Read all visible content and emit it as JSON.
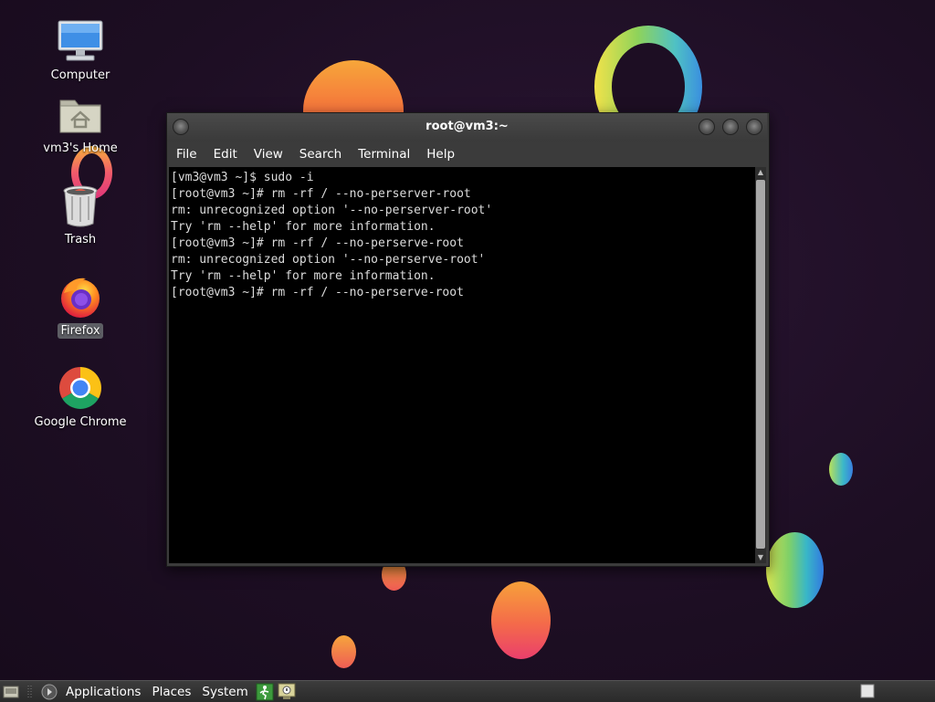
{
  "desktop": {
    "icons": [
      {
        "label": "Computer",
        "icon": "computer-icon"
      },
      {
        "label": "vm3's Home",
        "icon": "home-folder-icon"
      },
      {
        "label": "Trash",
        "icon": "trash-icon"
      },
      {
        "label": "Firefox",
        "icon": "firefox-icon"
      },
      {
        "label": "Google Chrome",
        "icon": "chrome-icon"
      }
    ]
  },
  "terminal": {
    "title": "root@vm3:~",
    "menu": [
      "File",
      "Edit",
      "View",
      "Search",
      "Terminal",
      "Help"
    ],
    "lines": [
      "[vm3@vm3 ~]$ sudo -i",
      "[root@vm3 ~]# rm -rf / --no-perserver-root",
      "rm: unrecognized option '--no-perserver-root'",
      "Try 'rm --help' for more information.",
      "[root@vm3 ~]# rm -rf / --no-perserve-root",
      "rm: unrecognized option '--no-perserve-root'",
      "Try 'rm --help' for more information.",
      "[root@vm3 ~]# rm -rf / --no-perserve-root"
    ]
  },
  "panel": {
    "applications": "Applications",
    "places": "Places",
    "system": "System"
  }
}
